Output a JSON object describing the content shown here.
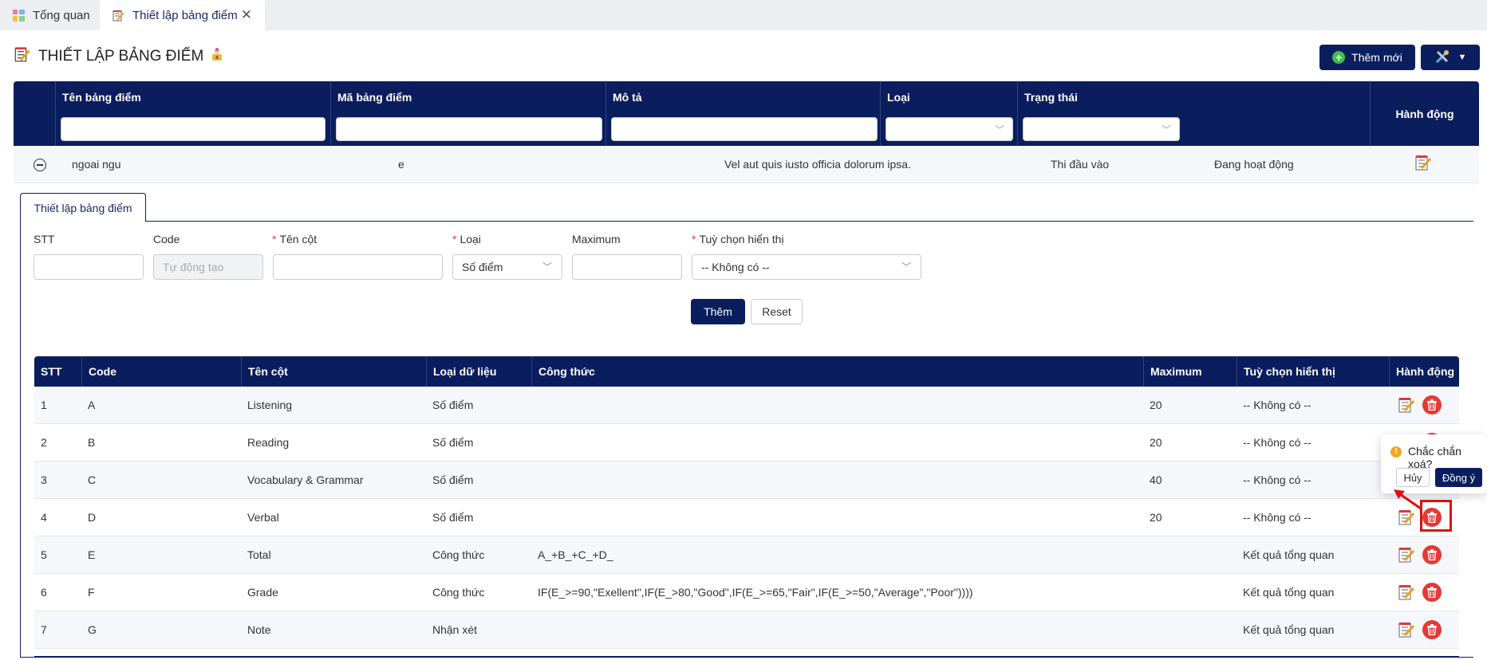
{
  "tabs": [
    {
      "label": "Tổng quan",
      "icon": "dashboard-icon"
    },
    {
      "label": "Thiết lập bảng điểm",
      "icon": "notepad-edit-icon",
      "active": true
    }
  ],
  "header": {
    "title": "THIẾT LẬP BẢNG ĐIỂM",
    "add_label": "Thêm mới"
  },
  "grid": {
    "columns": [
      "Tên bảng điểm",
      "Mã bảng điểm",
      "Mô tả",
      "Loại",
      "Trạng thái",
      "Hành động"
    ],
    "row": {
      "name": "ngoai ngu",
      "code": "e",
      "description": "Vel aut quis iusto officia dolorum ipsa.",
      "type": "Thi đầu vào",
      "status": "Đang hoạt động"
    }
  },
  "subtab": {
    "label": "Thiết lập bảng điểm"
  },
  "form": {
    "stt_label": "STT",
    "code_label": "Code",
    "code_placeholder": "Tự động tạo",
    "name_label": "Tên cột",
    "type_label": "Loại",
    "type_value": "Số điểm",
    "max_label": "Maximum",
    "display_label": "Tuỳ chọn hiển thị",
    "display_value": "-- Không có --",
    "submit_label": "Thêm",
    "reset_label": "Reset"
  },
  "table": {
    "columns": [
      "STT",
      "Code",
      "Tên cột",
      "Loại dữ liệu",
      "Công thức",
      "Maximum",
      "Tuỳ chọn hiển thị",
      "Hành động"
    ],
    "rows": [
      {
        "stt": "1",
        "code": "A",
        "name": "Listening",
        "type": "Số điểm",
        "formula": "",
        "max": "20",
        "display": "-- Không có --"
      },
      {
        "stt": "2",
        "code": "B",
        "name": "Reading",
        "type": "Số điểm",
        "formula": "",
        "max": "20",
        "display": "-- Không có --"
      },
      {
        "stt": "3",
        "code": "C",
        "name": "Vocabulary & Grammar",
        "type": "Số điểm",
        "formula": "",
        "max": "40",
        "display": "-- Không có --"
      },
      {
        "stt": "4",
        "code": "D",
        "name": "Verbal",
        "type": "Số điểm",
        "formula": "",
        "max": "20",
        "display": "-- Không có --"
      },
      {
        "stt": "5",
        "code": "E",
        "name": "Total",
        "type": "Công thức",
        "formula": "A_+B_+C_+D_",
        "max": "",
        "display": "Kết quả tổng quan"
      },
      {
        "stt": "6",
        "code": "F",
        "name": "Grade",
        "type": "Công thức",
        "formula": "IF(E_>=90,\"Exellent\",IF(E_>80,\"Good\",IF(E_>=65,\"Fair\",IF(E_>=50,\"Average\",\"Poor\"))))",
        "max": "",
        "display": "Kết quả tổng quan"
      },
      {
        "stt": "7",
        "code": "G",
        "name": "Note",
        "type": "Nhận xét",
        "formula": "",
        "max": "",
        "display": "Kết quả tổng quan"
      }
    ]
  },
  "popconfirm": {
    "text": "Chắc chắn xoá?",
    "cancel_label": "Hủy",
    "ok_label": "Đồng ý"
  },
  "colors": {
    "navy": "#0a1e5e",
    "danger": "#e53935",
    "success": "#3fbf4a",
    "warning": "#f5a623"
  }
}
